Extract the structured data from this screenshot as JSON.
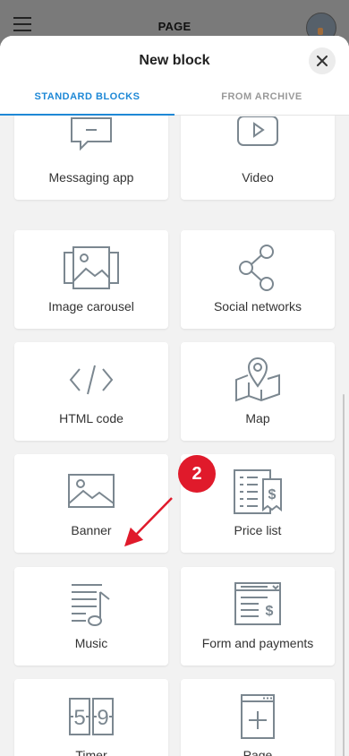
{
  "appbar": {
    "title": "PAGE"
  },
  "sheet": {
    "title": "New block",
    "tabs": [
      {
        "label": "STANDARD BLOCKS",
        "active": true
      },
      {
        "label": "FROM ARCHIVE",
        "active": false
      }
    ]
  },
  "blocks": [
    {
      "label": "Messaging app",
      "icon": "chat-icon"
    },
    {
      "label": "Video",
      "icon": "video-icon"
    },
    {
      "label": "Image carousel",
      "icon": "image-carousel-icon"
    },
    {
      "label": "Social networks",
      "icon": "share-icon"
    },
    {
      "label": "HTML code",
      "icon": "code-icon"
    },
    {
      "label": "Map",
      "icon": "map-pin-icon"
    },
    {
      "label": "Banner",
      "icon": "banner-image-icon"
    },
    {
      "label": "Price list",
      "icon": "price-list-icon"
    },
    {
      "label": "Music",
      "icon": "music-icon"
    },
    {
      "label": "Form and payments",
      "icon": "form-payment-icon"
    },
    {
      "label": "Timer",
      "icon": "timer-icon"
    },
    {
      "label": "Page",
      "icon": "add-page-icon"
    }
  ],
  "annotation": {
    "step": "2",
    "color": "#e01a2b"
  },
  "colors": {
    "accent": "#1e88d6",
    "icon": "#7b8790"
  }
}
